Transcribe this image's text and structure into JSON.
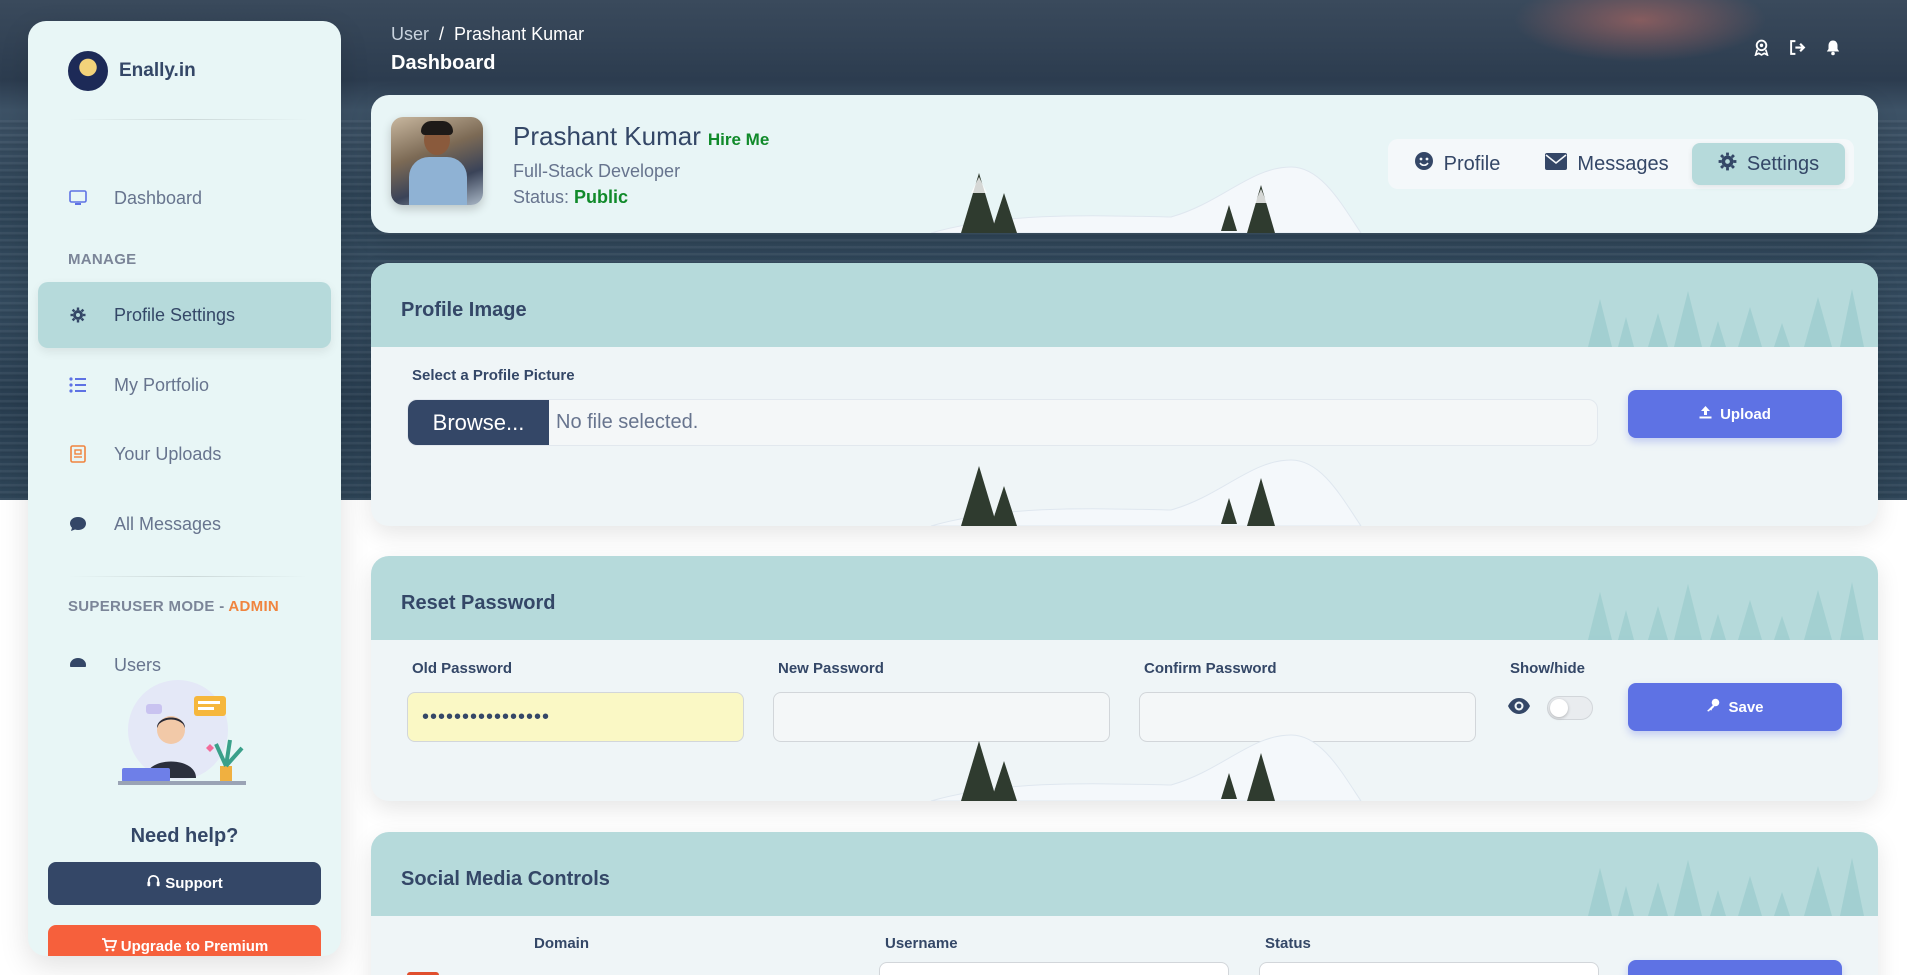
{
  "brand": {
    "name": "Enally.in"
  },
  "breadcrumb": {
    "root": "User",
    "separator": "/",
    "current": "Prashant Kumar"
  },
  "page_title": "Dashboard",
  "sidebar": {
    "items": [
      {
        "label": "Dashboard",
        "icon": "monitor-icon"
      },
      {
        "label": "Profile Settings",
        "icon": "gear-icon"
      },
      {
        "label": "My Portfolio",
        "icon": "list-icon"
      },
      {
        "label": "Your Uploads",
        "icon": "uploads-icon"
      },
      {
        "label": "All Messages",
        "icon": "chat-icon"
      },
      {
        "label": "Users",
        "icon": "users-icon"
      }
    ],
    "section_manage": "MANAGE",
    "section_superuser": "SUPERUSER MODE - ",
    "section_admin": "ADMIN",
    "need_help": "Need help?",
    "support_label": "Support",
    "upgrade_label": "Upgrade to Premium"
  },
  "profile": {
    "name": "Prashant Kumar",
    "hire_me": "Hire Me",
    "role": "Full-Stack Developer",
    "status_label": "Status:",
    "status_value": "Public"
  },
  "tabs": [
    {
      "label": "Profile",
      "icon": "smile-icon"
    },
    {
      "label": "Messages",
      "icon": "envelope-icon"
    },
    {
      "label": "Settings",
      "icon": "gear-icon"
    }
  ],
  "profile_image": {
    "title": "Profile Image",
    "select_label": "Select a Profile Picture",
    "browse_label": "Browse...",
    "file_status": "No file selected.",
    "upload_label": "Upload"
  },
  "reset_password": {
    "title": "Reset Password",
    "old_label": "Old Password",
    "old_value": "••••••••••••••••",
    "new_label": "New Password",
    "confirm_label": "Confirm Password",
    "showhide_label": "Show/hide",
    "save_label": "Save"
  },
  "social": {
    "title": "Social Media Controls",
    "col_domain": "Domain",
    "col_username": "Username",
    "col_status": "Status"
  },
  "colors": {
    "accent": "#5e72e4",
    "dark": "#344767",
    "teal": "#b6dadb",
    "orange": "#f6603c",
    "green": "#108a2a"
  }
}
